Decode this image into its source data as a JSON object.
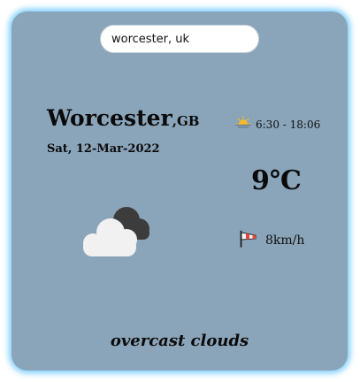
{
  "search": {
    "value": "worcester, uk",
    "placeholder": ""
  },
  "location": {
    "city": "Worcester",
    "country": ",GB"
  },
  "date": "Sat, 12-Mar-2022",
  "sun": {
    "icon": "sunrise-sunset-icon",
    "times": "6:30 - 18:06"
  },
  "temperature": "9℃",
  "weather": {
    "icon": "overcast-clouds-icon",
    "description": "overcast clouds"
  },
  "wind": {
    "icon": "windsock-icon",
    "speed": "8km/h"
  },
  "colors": {
    "card_background": "#8aa4b9",
    "card_glow": "#50beff"
  }
}
